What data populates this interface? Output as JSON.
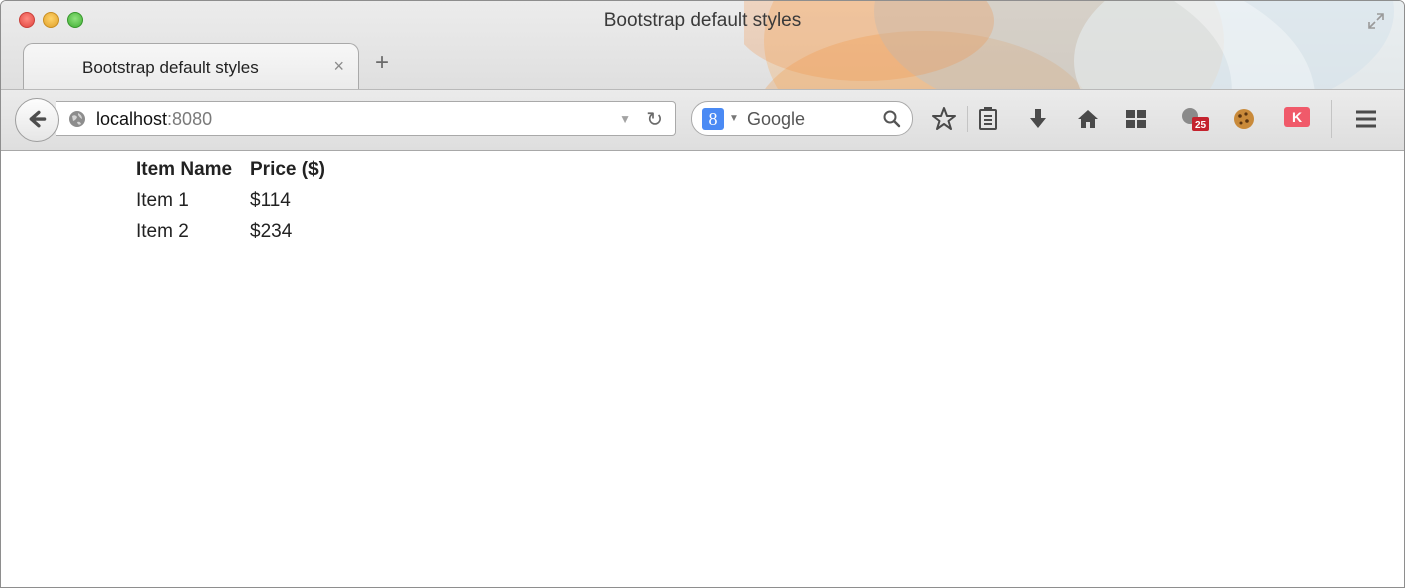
{
  "window": {
    "title": "Bootstrap default styles"
  },
  "tabs": [
    {
      "label": "Bootstrap default styles",
      "close": "×"
    }
  ],
  "new_tab": "+",
  "url": {
    "host": "localhost",
    "port": ":8080"
  },
  "search": {
    "engine_letter": "8",
    "placeholder": "Google"
  },
  "toolbar_icons": [
    "star-icon",
    "reading-list-icon",
    "download-icon",
    "home-icon",
    "apps-grid-icon",
    "calendar-extension-icon",
    "cookie-extension-icon",
    "k-extension-icon",
    "menu-icon"
  ],
  "extension_badge": "25",
  "k_badge": "K",
  "table": {
    "headers": [
      "Item Name",
      "Price ($)"
    ],
    "rows": [
      {
        "name": "Item 1",
        "price": "$114"
      },
      {
        "name": "Item 2",
        "price": "$234"
      }
    ]
  },
  "colors": {
    "close": "#e0443e",
    "minimize": "#e0a02a",
    "maximize": "#3fae33",
    "google": "#4a8af4",
    "badge": "#c4232e"
  }
}
